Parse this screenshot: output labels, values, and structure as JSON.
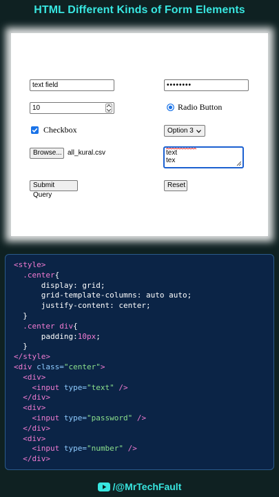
{
  "title": "HTML Different Kinds of Form Elements",
  "form": {
    "text_value": "text field",
    "password_value": "••••••••",
    "number_value": "10",
    "radio_label": "Radio Button",
    "checkbox_label": "Checkbox",
    "select_value": "Option 3",
    "file_button": "Browse...",
    "file_name": "all_kural.csv",
    "textarea_value": "text\ntex",
    "submit_label": "Submit Query",
    "reset_label": "Reset"
  },
  "code_lines": [
    [
      [
        "tag",
        "<style>"
      ]
    ],
    [
      [
        "prop",
        "  "
      ],
      [
        "tag",
        ".center"
      ],
      [
        "prop",
        "{"
      ]
    ],
    [
      [
        "prop",
        "      display: grid;"
      ]
    ],
    [
      [
        "prop",
        "      grid-template-columns: auto auto;"
      ]
    ],
    [
      [
        "prop",
        "      justify-content: center;"
      ]
    ],
    [
      [
        "prop",
        "  }"
      ]
    ],
    [
      [
        "prop",
        "  "
      ],
      [
        "tag",
        ".center div"
      ],
      [
        "prop",
        "{"
      ]
    ],
    [
      [
        "prop",
        "      padding:"
      ],
      [
        "tag",
        "10px"
      ],
      [
        "prop",
        ";"
      ]
    ],
    [
      [
        "prop",
        "  }"
      ]
    ],
    [
      [
        "tag",
        "</style>"
      ]
    ],
    [
      [
        "tag",
        "<div "
      ],
      [
        "attr",
        "class="
      ],
      [
        "str",
        "\"center\""
      ],
      [
        "tag",
        ">"
      ]
    ],
    [
      [
        "prop",
        "  "
      ],
      [
        "tag",
        "<div>"
      ]
    ],
    [
      [
        "prop",
        "    "
      ],
      [
        "tag",
        "<input "
      ],
      [
        "attr",
        "type="
      ],
      [
        "str",
        "\"text\""
      ],
      [
        "tag",
        " />"
      ]
    ],
    [
      [
        "prop",
        "  "
      ],
      [
        "tag",
        "</div>"
      ]
    ],
    [
      [
        "prop",
        "  "
      ],
      [
        "tag",
        "<div>"
      ]
    ],
    [
      [
        "prop",
        "    "
      ],
      [
        "tag",
        "<input "
      ],
      [
        "attr",
        "type="
      ],
      [
        "str",
        "\"password\""
      ],
      [
        "tag",
        " />"
      ]
    ],
    [
      [
        "prop",
        "  "
      ],
      [
        "tag",
        "</div>"
      ]
    ],
    [
      [
        "prop",
        "  "
      ],
      [
        "tag",
        "<div>"
      ]
    ],
    [
      [
        "prop",
        "    "
      ],
      [
        "tag",
        "<input "
      ],
      [
        "attr",
        "type="
      ],
      [
        "str",
        "\"number\""
      ],
      [
        "tag",
        " />"
      ]
    ],
    [
      [
        "prop",
        "  "
      ],
      [
        "tag",
        "</div>"
      ]
    ]
  ],
  "footer": {
    "handle": "/@MrTechFault",
    "icon": "youtube-icon"
  },
  "colors": {
    "accent": "#38e6e0",
    "background": "#0f2122",
    "code_bg": "#0b2446",
    "checkbox_blue": "#1a73e8"
  }
}
